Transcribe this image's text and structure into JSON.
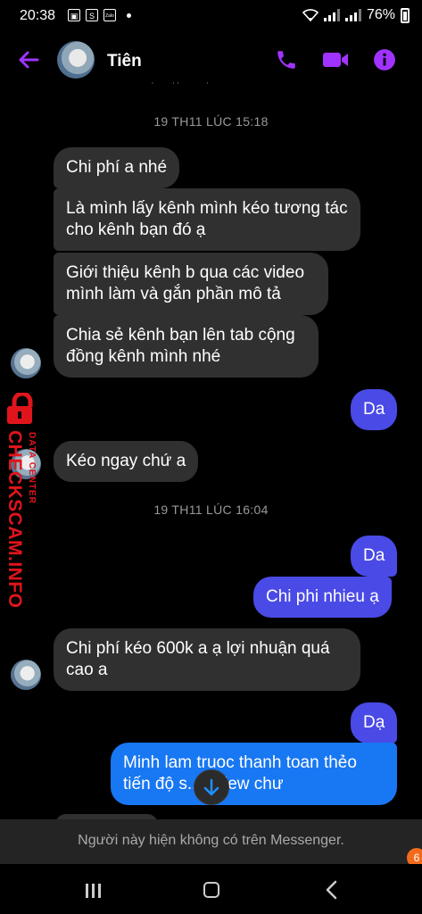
{
  "status_bar": {
    "time": "20:38",
    "battery": "76%",
    "app_icon_label": "Zalo"
  },
  "header": {
    "contact_name": "Tiên",
    "accent_color": "#a033ff"
  },
  "conversation": {
    "timestamp_1": "19 TH11 LÚC 15:18",
    "timestamp_2": "19 TH11 LÚC 16:04",
    "messages": [
      "Chi phí a nhé",
      "Là mình lấy kênh mình kéo tương tác cho kênh bạn đó ạ",
      "Giới thiệu kênh b qua các video mình làm và gắn phần mô tả",
      "Chia sẻ kênh bạn lên tab cộng đồng kênh mình nhé",
      "Da",
      "Kéo ngay chứ a",
      "Da",
      "Chi phi nhieu ạ",
      "Chi phí kéo 600k a ạ lợi nhuận quá cao a",
      "Dạ",
      "Minh lam truoc thanh toan thẻo tiến độ s...à view chư"
    ]
  },
  "watermark": {
    "main": "CHECKSCAM.INFO",
    "sub": "DATA CENTER"
  },
  "footer": {
    "banner": "Người này hiện không có trên Messenger."
  }
}
